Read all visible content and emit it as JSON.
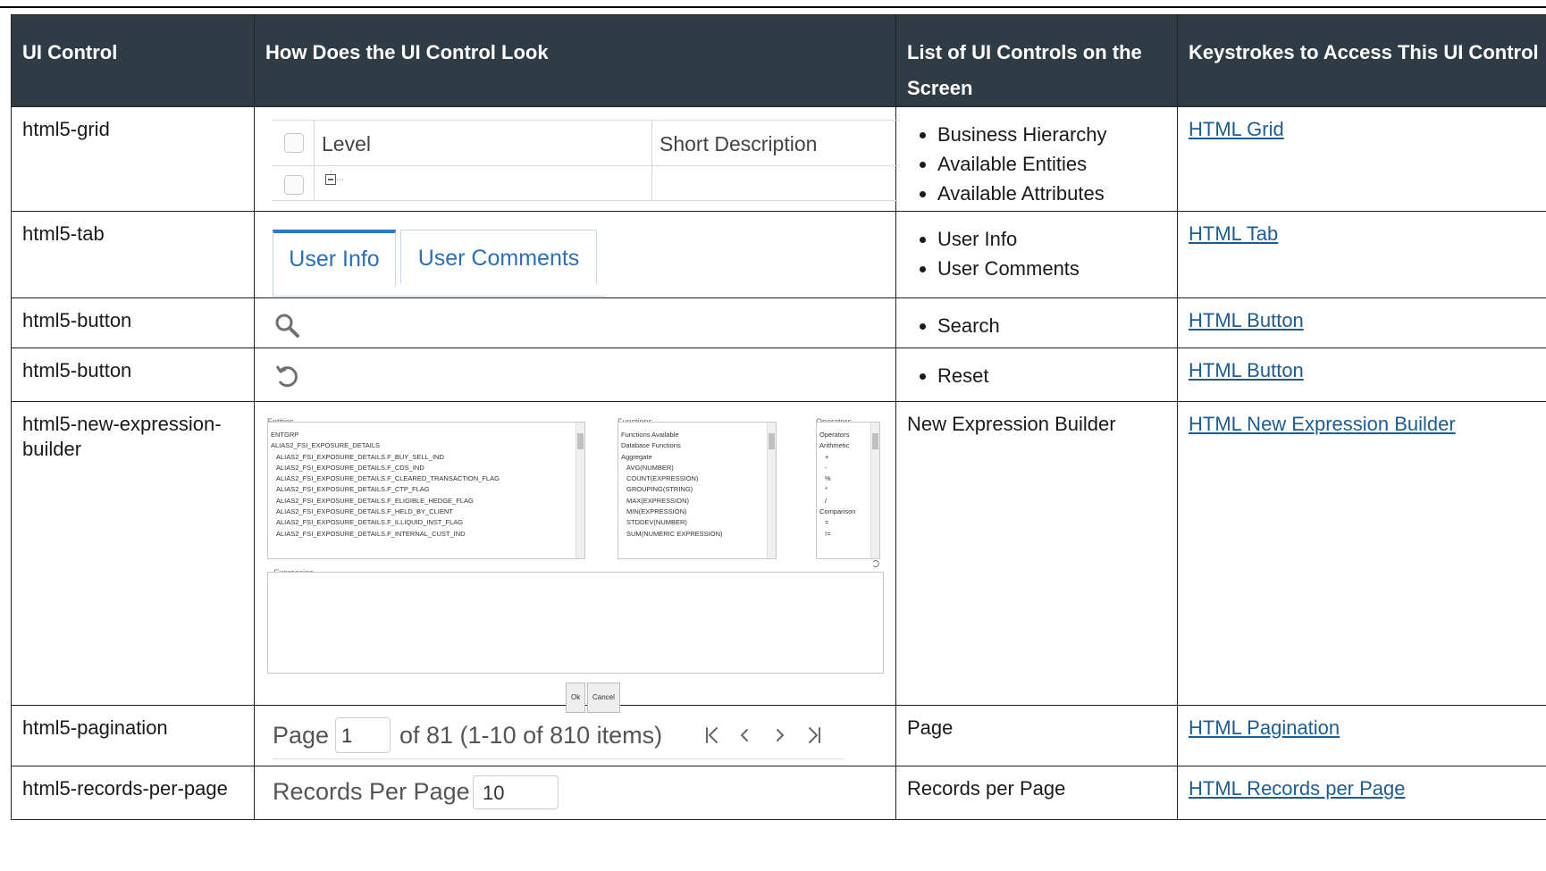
{
  "headers": {
    "c1": "UI Control",
    "c2": "How Does the UI Control Look",
    "c3": "List of UI Controls on the Screen",
    "c4": "Keystrokes to Access This UI Control"
  },
  "rows": [
    {
      "control": "html5-grid",
      "items": [
        "Business Hierarchy",
        "Available Entities",
        "Available Attributes"
      ],
      "link": "HTML Grid"
    },
    {
      "control": "html5-tab",
      "items": [
        "User Info",
        "User Comments"
      ],
      "link": "HTML Tab"
    },
    {
      "control": "html5-button",
      "items": [
        "Search"
      ],
      "link": "HTML Button"
    },
    {
      "control": "html5-button",
      "items": [
        "Reset"
      ],
      "link": "HTML Button"
    },
    {
      "control": "html5-new-expression-builder",
      "text": "New Expression Builder",
      "link": "HTML New Expression Builder"
    },
    {
      "control": "html5-pagination",
      "text": "Page",
      "link": "HTML Pagination"
    },
    {
      "control": "html5-records-per-page",
      "text": "Records per Page",
      "link": "HTML Records per Page"
    }
  ],
  "grid_ill": {
    "col1": "Level",
    "col2": "Short Description"
  },
  "tab_ill": {
    "tab1": "User Info",
    "tab2": "User Comments"
  },
  "expr_ill": {
    "entities_label": "Entities",
    "functions_label": "Functions",
    "operators_label": "Operators",
    "entities": [
      "ENTGRP",
      "ALIAS2_FSI_EXPOSURE_DETAILS",
      "ALIAS2_FSI_EXPOSURE_DETAILS.F_BUY_SELL_IND",
      "ALIAS2_FSI_EXPOSURE_DETAILS.F_CDS_IND",
      "ALIAS2_FSI_EXPOSURE_DETAILS.F_CLEARED_TRANSACTION_FLAG",
      "ALIAS2_FSI_EXPOSURE_DETAILS.F_CTP_FLAG",
      "ALIAS2_FSI_EXPOSURE_DETAILS.F_ELIGIBLE_HEDGE_FLAG",
      "ALIAS2_FSI_EXPOSURE_DETAILS.F_HELD_BY_CLIENT",
      "ALIAS2_FSI_EXPOSURE_DETAILS.F_ILLIQUID_INST_FLAG",
      "ALIAS2_FSI_EXPOSURE_DETAILS.F_INTERNAL_CUST_IND"
    ],
    "functions": [
      "Functions Available",
      "Database Functions",
      "Aggregate",
      "AVG(NUMBER)",
      "COUNT(EXPRESSION)",
      "GROUPING(STRING)",
      "MAX(EXPRESSION)",
      "MIN(EXPRESSION)",
      "STDDEV(NUMBER)",
      "SUM(NUMERIC EXPRESSION)"
    ],
    "operators": [
      "Operators",
      "Arithmetic",
      "+",
      "-",
      "%",
      "*",
      "/",
      "Comparison",
      "=",
      "!="
    ],
    "expression_label": "Expression",
    "ok": "Ok",
    "cancel": "Cancel"
  },
  "pagination_ill": {
    "page_label": "Page",
    "page_value": "1",
    "of_text": "of 81 (1-10 of 810 items)"
  },
  "rpp_ill": {
    "label": "Records Per Page",
    "value": "10"
  }
}
